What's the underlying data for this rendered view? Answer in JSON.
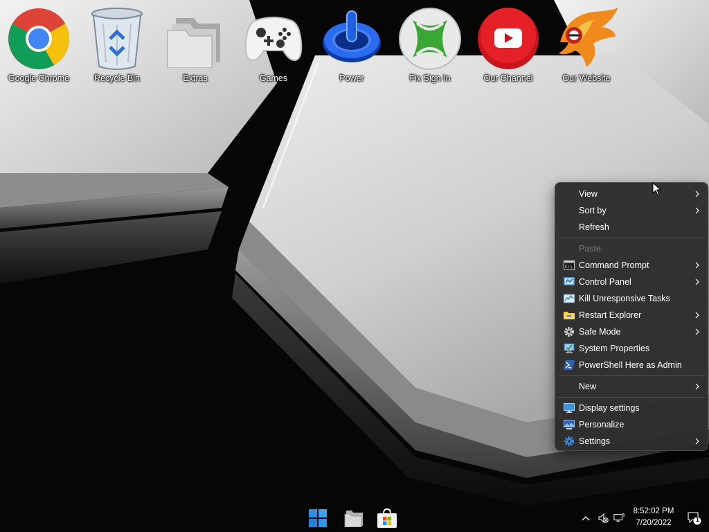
{
  "desktop": {
    "icons": [
      {
        "label": "Google Chrome",
        "icon": "chrome-icon"
      },
      {
        "label": "Recycle Bin",
        "icon": "recycle-bin-icon"
      },
      {
        "label": "Extras",
        "icon": "folder-icon"
      },
      {
        "label": "Games",
        "icon": "gamepad-icon"
      },
      {
        "label": "Power",
        "icon": "power-icon"
      },
      {
        "label": "Fix Sign In",
        "icon": "xbox-icon"
      },
      {
        "label": "Our Channel",
        "icon": "youtube-icon"
      },
      {
        "label": "Our Website",
        "icon": "phoenix-logo-icon"
      }
    ]
  },
  "context_menu": {
    "items": [
      {
        "label": "View",
        "submenu": true,
        "icon": null
      },
      {
        "label": "Sort by",
        "submenu": true,
        "icon": null
      },
      {
        "label": "Refresh",
        "submenu": false,
        "icon": null
      },
      {
        "label": "Paste",
        "submenu": false,
        "icon": null,
        "disabled": true
      },
      {
        "label": "Command Prompt",
        "submenu": true,
        "icon": "command-prompt-icon"
      },
      {
        "label": "Control Panel",
        "submenu": true,
        "icon": "control-panel-icon"
      },
      {
        "label": "Kill Unresponsive Tasks",
        "submenu": false,
        "icon": "kill-tasks-icon"
      },
      {
        "label": "Restart Explorer",
        "submenu": true,
        "icon": "explorer-folder-icon"
      },
      {
        "label": "Safe Mode",
        "submenu": true,
        "icon": "gear-icon"
      },
      {
        "label": "System Properties",
        "submenu": false,
        "icon": "system-properties-icon"
      },
      {
        "label": "PowerShell Here as Admin",
        "submenu": false,
        "icon": "powershell-icon"
      },
      {
        "label": "New",
        "submenu": true,
        "icon": null
      },
      {
        "label": "Display settings",
        "submenu": false,
        "icon": "display-icon"
      },
      {
        "label": "Personalize",
        "submenu": false,
        "icon": "personalize-icon"
      },
      {
        "label": "Settings",
        "submenu": true,
        "icon": "settings-gear-icon"
      }
    ]
  },
  "taskbar": {
    "buttons": [
      {
        "icon": "windows-start-icon"
      },
      {
        "icon": "file-explorer-icon"
      },
      {
        "icon": "microsoft-store-icon"
      }
    ],
    "tray": {
      "time": "8:52:02 PM",
      "date": "7/20/2022",
      "notification_count": "1"
    }
  },
  "colors": {
    "menu_bg": "#2c2c2c",
    "menu_text": "#ffffff",
    "menu_disabled_text": "#7a7a7a"
  }
}
